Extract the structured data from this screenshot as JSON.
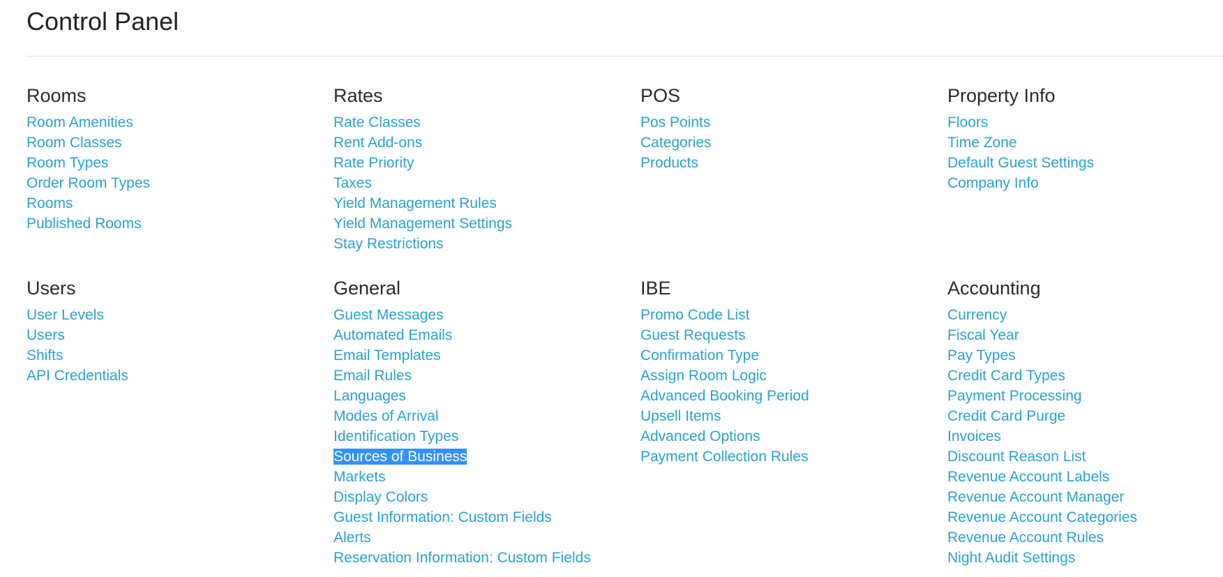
{
  "page": {
    "title": "Control Panel"
  },
  "colors": {
    "link": "#2aa2cf",
    "selection": "#3390ff",
    "title": "#222222"
  },
  "sections": [
    {
      "title": "Rooms",
      "links": [
        "Room Amenities",
        "Room Classes",
        "Room Types",
        "Order Room Types",
        "Rooms",
        "Published Rooms"
      ]
    },
    {
      "title": "Rates",
      "links": [
        "Rate Classes",
        "Rent Add-ons",
        "Rate Priority",
        "Taxes",
        "Yield Management Rules",
        "Yield Management Settings",
        "Stay Restrictions"
      ]
    },
    {
      "title": "POS",
      "links": [
        "Pos Points",
        "Categories",
        "Products"
      ]
    },
    {
      "title": "Property Info",
      "links": [
        "Floors",
        "Time Zone",
        "Default Guest Settings",
        "Company Info"
      ]
    },
    {
      "title": "Users",
      "links": [
        "User Levels",
        "Users",
        "Shifts",
        "API Credentials"
      ]
    },
    {
      "title": "General",
      "links": [
        "Guest Messages",
        "Automated Emails",
        "Email Templates",
        "Email Rules",
        "Languages",
        "Modes of Arrival",
        "Identification Types",
        "Sources of Business",
        "Markets",
        "Display Colors",
        "Guest Information: Custom Fields",
        "Alerts",
        "Reservation Information: Custom Fields"
      ]
    },
    {
      "title": "IBE",
      "links": [
        "Promo Code List",
        "Guest Requests",
        "Confirmation Type",
        "Assign Room Logic",
        "Advanced Booking Period",
        "Upsell Items",
        "Advanced Options",
        "Payment Collection Rules"
      ]
    },
    {
      "title": "Accounting",
      "links": [
        "Currency",
        "Fiscal Year",
        "Pay Types",
        "Credit Card Types",
        "Payment Processing",
        "Credit Card Purge",
        "Invoices",
        "Discount Reason List",
        "Revenue Account Labels",
        "Revenue Account Manager",
        "Revenue Account Categories",
        "Revenue Account Rules",
        "Night Audit Settings"
      ]
    }
  ]
}
